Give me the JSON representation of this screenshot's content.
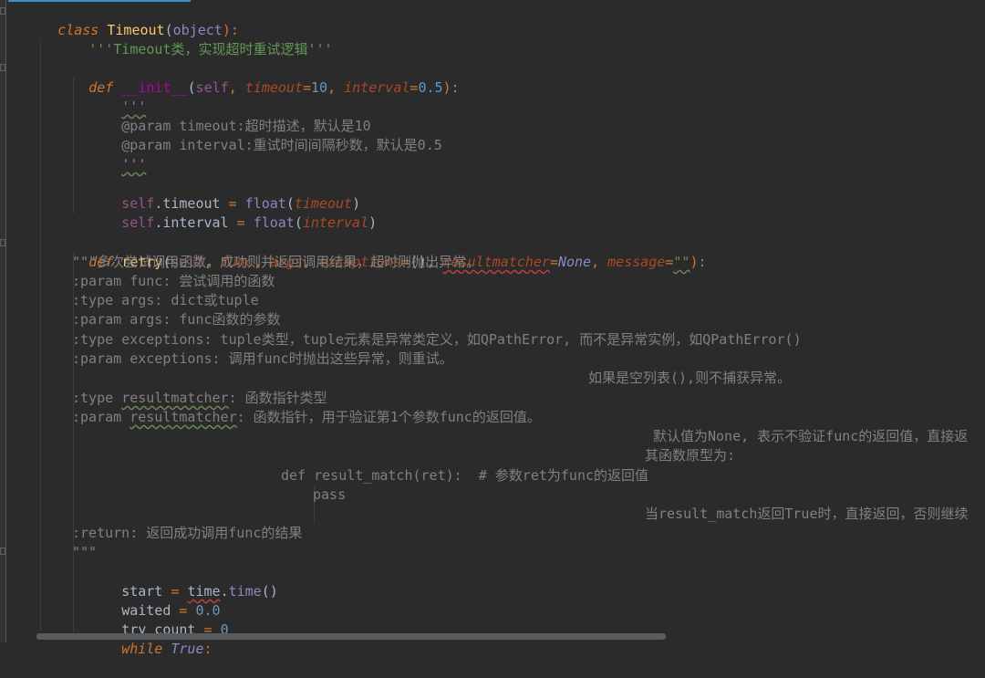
{
  "lines": {
    "l1": {
      "kw": "class",
      "name": "Timeout",
      "p1": "(",
      "base": "object",
      "p2": "):"
    },
    "l2": {
      "text": "'''Timeout类，实现超时重试逻辑'''"
    },
    "l4": {
      "kw": "def",
      "name": "__init__",
      "p1": "(",
      "self": "self",
      "c1": ", ",
      "a1": "timeout",
      "e1": "=",
      "v1": "10",
      "c2": ", ",
      "a2": "interval",
      "e2": "=",
      "v2": "0.5",
      "p2": "):"
    },
    "l5": {
      "text": "'''"
    },
    "l6": {
      "tag": "@param",
      "text": " timeout:超时描述，默认是10"
    },
    "l7": {
      "tag": "@param",
      "text": " interval:重试时间间隔秒数，默认是0.5"
    },
    "l8": {
      "text": "'''"
    },
    "l10": {
      "self": "self",
      "attr": ".timeout ",
      "eq": "=",
      "sp": " ",
      "fn": "float",
      "p1": "(",
      "arg": "timeout",
      "p2": ")"
    },
    "l11": {
      "self": "self",
      "attr": ".interval ",
      "eq": "=",
      "sp": " ",
      "fn": "float",
      "p1": "(",
      "arg": "interval",
      "p2": ")"
    },
    "l13": {
      "kw": "def",
      "name": "retry",
      "p1": "(",
      "self": "self",
      "c1": ", ",
      "a1": "func",
      "c2": ", ",
      "a2": "args",
      "c3": ", ",
      "a3": "exceptions",
      "e3": "=",
      "v3": "()",
      "c4": ", ",
      "a4": "resultmatcher",
      "e4": "=",
      "v4": "None",
      "c5": ", ",
      "a5": "message",
      "e5": "=",
      "v5": "\"\"",
      "p2": "):"
    },
    "l14": {
      "text": "\"\"\"多次尝试调用函数，成功则并返回调用结果，超时则抛出异常。"
    },
    "l15": {
      "text": ":param func: 尝试调用的函数"
    },
    "l16": {
      "text": ":type args: dict或tuple"
    },
    "l17": {
      "text": ":param args: func函数的参数"
    },
    "l18": {
      "text": ":type exceptions: tuple类型，tuple元素是异常类定义，如QPathError, 而不是异常实例，如QPathError()"
    },
    "l19": {
      "text": ":param exceptions: 调用func时抛出这些异常，则重试。"
    },
    "l20": {
      "text": "如果是空列表(),则不捕获异常。"
    },
    "l21": {
      "pre": ":type ",
      "word": "resultmatcher",
      "post": ": 函数指针类型"
    },
    "l22": {
      "pre": ":param ",
      "word": "resultmatcher",
      "post": ": 函数指针，用于验证第1个参数func的返回值。"
    },
    "l23": {
      "text": "默认值为None, 表示不验证func的返回值，直接返"
    },
    "l24": {
      "text": "其函数原型为:"
    },
    "l25": {
      "text": "def result_match(ret):  # 参数ret为func的返回值"
    },
    "l26": {
      "text": "pass"
    },
    "l27": {
      "text": "当result_match返回True时，直接返回，否则继续"
    },
    "l28": {
      "text": ":return: 返回成功调用func的结果"
    },
    "l29": {
      "text": "\"\"\""
    },
    "l30": {
      "v": "start ",
      "eq": "=",
      "sp": " ",
      "mod": "time",
      "dot": ".",
      "fn": "time",
      "call": "()"
    },
    "l31": {
      "v": "waited ",
      "eq": "=",
      "sp": " ",
      "num": "0.0"
    },
    "l32": {
      "v": "try_count ",
      "eq": "=",
      "sp": " ",
      "num": "0"
    },
    "l33": {
      "kw": "while",
      "sp": " ",
      "const": "True",
      "colon": ":"
    }
  },
  "colors": {
    "background": "#2b2b2b",
    "keyword": "#cc7832",
    "function": "#ffc66d",
    "self": "#94558d",
    "parameter": "#aa4926",
    "number": "#6897bb",
    "docstring": "#629755"
  }
}
